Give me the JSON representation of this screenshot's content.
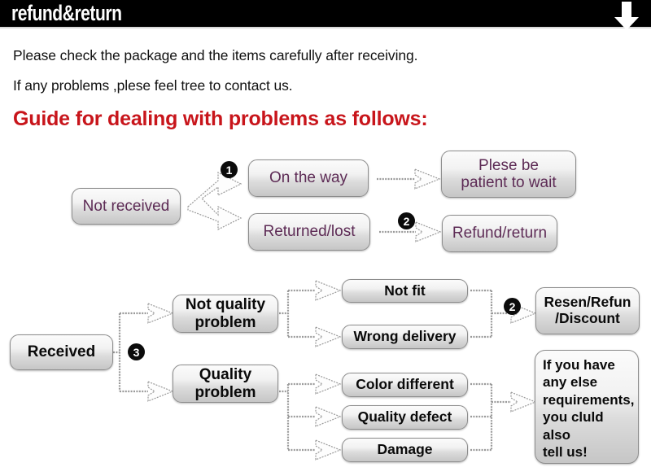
{
  "header": {
    "title": "refund&return",
    "arrow_icon": "arrow-down-icon"
  },
  "intro": {
    "line1": "Please check the package and the items carefully after receiving.",
    "line2": "If any problems ,plese feel tree to contact us.",
    "heading": "Guide for dealing with problems as follows:",
    "heading_color": "#c8151b"
  },
  "flow_not_received": {
    "source": "Not received",
    "branches": [
      {
        "badge": "1",
        "label": "On the way",
        "result_badge": "",
        "result": "Plese be\npatient to wait",
        "result_line1": "Plese be",
        "result_line2": "patient to wait"
      },
      {
        "badge": "",
        "label": "Returned/lost",
        "result_badge": "2",
        "result": "Refund/return"
      }
    ]
  },
  "flow_received": {
    "source": "Received",
    "source_badge": "3",
    "groups": [
      {
        "label_line1": "Not quality",
        "label_line2": "problem",
        "items": [
          "Not fit",
          "Wrong delivery"
        ],
        "outcome_badge": "2",
        "outcome_line1": "Resen/Refun",
        "outcome_line2": "/Discount"
      },
      {
        "label_line1": "Quality",
        "label_line2": "problem",
        "items": [
          "Color different",
          "Quality defect",
          "Damage"
        ],
        "outcome_badge": "",
        "outcome_lines": [
          "If you have",
          "any else",
          "requirements,",
          "you cluld also",
          "tell us!"
        ]
      }
    ]
  },
  "colors": {
    "header_bg": "#000000",
    "header_text": "#ffffff",
    "heading_red": "#c8151b",
    "box_text_purple": "#5d2b55",
    "box_text_dark": "#0a0a0a",
    "badge_bg": "#0b0b0b"
  }
}
